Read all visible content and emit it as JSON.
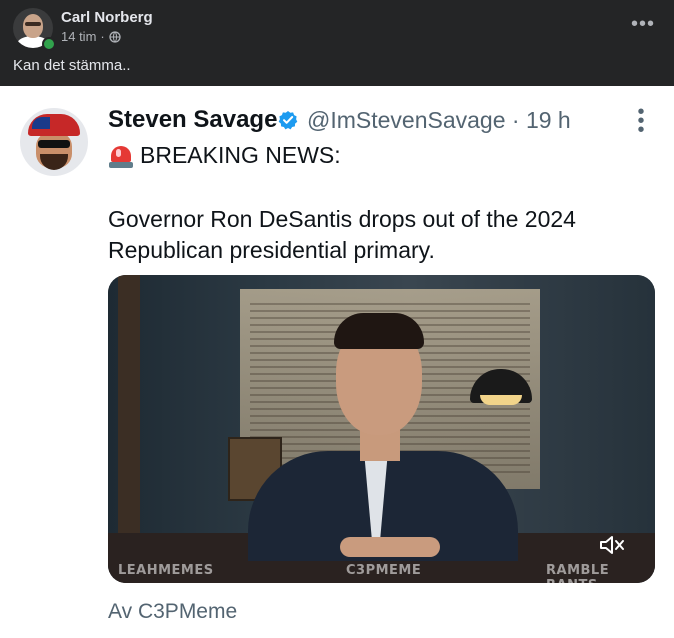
{
  "post": {
    "author_name": "Carl Norberg",
    "time_text": "14 tim",
    "separator": "·",
    "privacy_icon": "globe-icon",
    "more_label": "•••",
    "text": "Kan det stämma.."
  },
  "tweet": {
    "name": "Steven Savage",
    "handle_time": "@ImStevenSavage · 19 h",
    "more_label": "⋮",
    "siren_icon": "rotating-light-icon",
    "breaking": "BREAKING NEWS:",
    "body": "Governor Ron DeSantis drops out of the 2024 Republican presidential primary.",
    "media": {
      "watermark_left": "LEAHMEMES",
      "watermark_center": "C3PMEME",
      "watermark_right": "RAMBLE RANTS",
      "mute_icon": "speaker-muted-icon"
    },
    "footer": "Av C3PMeme"
  },
  "colors": {
    "fb_bg": "#242526",
    "fb_text": "#e4e6eb",
    "fb_meta": "#b0b3b8",
    "online": "#31a24c",
    "verified": "#1d9bf0",
    "tw_text": "#0f1419",
    "tw_muted": "#536471"
  }
}
